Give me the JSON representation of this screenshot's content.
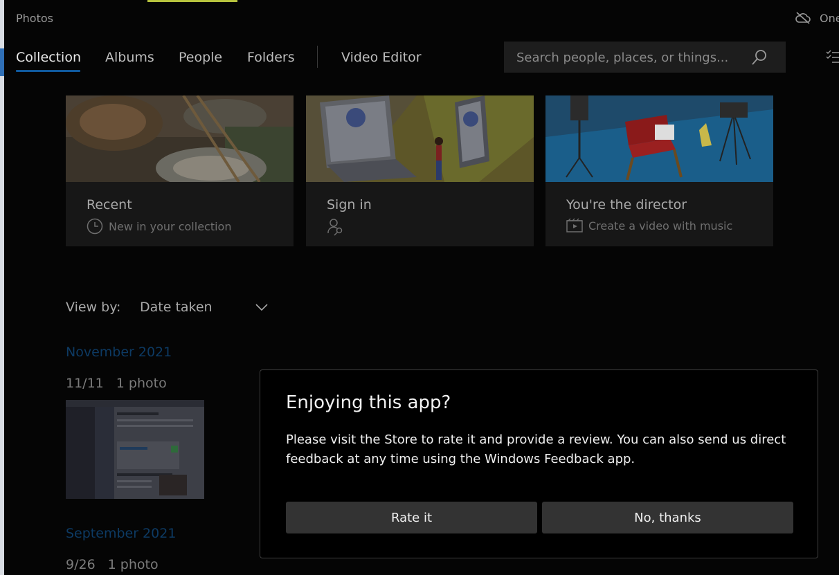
{
  "window": {
    "title": "Photos",
    "onedrive_label": "One"
  },
  "nav": {
    "tabs": [
      {
        "label": "Collection",
        "active": true
      },
      {
        "label": "Albums"
      },
      {
        "label": "People"
      },
      {
        "label": "Folders"
      },
      {
        "label": "Video Editor"
      }
    ]
  },
  "search": {
    "placeholder": "Search people, places, or things..."
  },
  "cards": [
    {
      "title": "Recent",
      "subtitle": "New in your collection",
      "icon": "clock-icon"
    },
    {
      "title": "Sign in",
      "subtitle": "",
      "icon": "person-key-icon"
    },
    {
      "title": "You're the director",
      "subtitle": "Create a video with music",
      "icon": "video-icon"
    }
  ],
  "view_by": {
    "label": "View by:",
    "value": "Date taken"
  },
  "timeline": [
    {
      "month": "November 2021",
      "date": "11/11",
      "count": "1 photo"
    },
    {
      "month": "September 2021",
      "date": "9/26",
      "count": "1 photo"
    }
  ],
  "dialog": {
    "title": "Enjoying this app?",
    "body": "Please visit the Store to rate it and provide a review. You can also send us direct feedback at any time using the Windows Feedback app.",
    "primary_button": "Rate it",
    "secondary_button": "No, thanks"
  },
  "colors": {
    "accent": "#0f5a9e",
    "month_text": "#0d3a63",
    "button": "#333333",
    "overlay": "#050505"
  }
}
